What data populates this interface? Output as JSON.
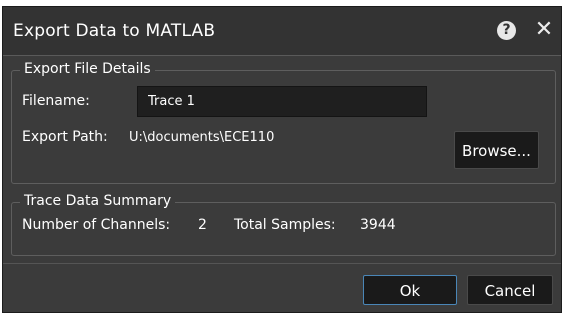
{
  "dialog": {
    "title": "Export Data to MATLAB",
    "help_glyph": "?",
    "close_glyph": "✕"
  },
  "export_details": {
    "legend": "Export File Details",
    "filename_label": "Filename:",
    "filename_value": "Trace 1",
    "path_label": "Export Path:",
    "path_value": "U:\\documents\\ECE110",
    "browse_label": "Browse..."
  },
  "summary": {
    "legend": "Trace Data Summary",
    "channels_label": "Number of Channels:",
    "channels_value": "2",
    "samples_label": "Total Samples:",
    "samples_value": "3944"
  },
  "footer": {
    "ok_label": "Ok",
    "cancel_label": "Cancel"
  },
  "colors": {
    "dialog_bg": "#3b3b3b",
    "titlebar_bg": "#333333",
    "input_bg": "#1f1f1f",
    "button_bg": "#1a1a1a",
    "ok_border": "#4a86b7",
    "text": "#ffffff"
  }
}
